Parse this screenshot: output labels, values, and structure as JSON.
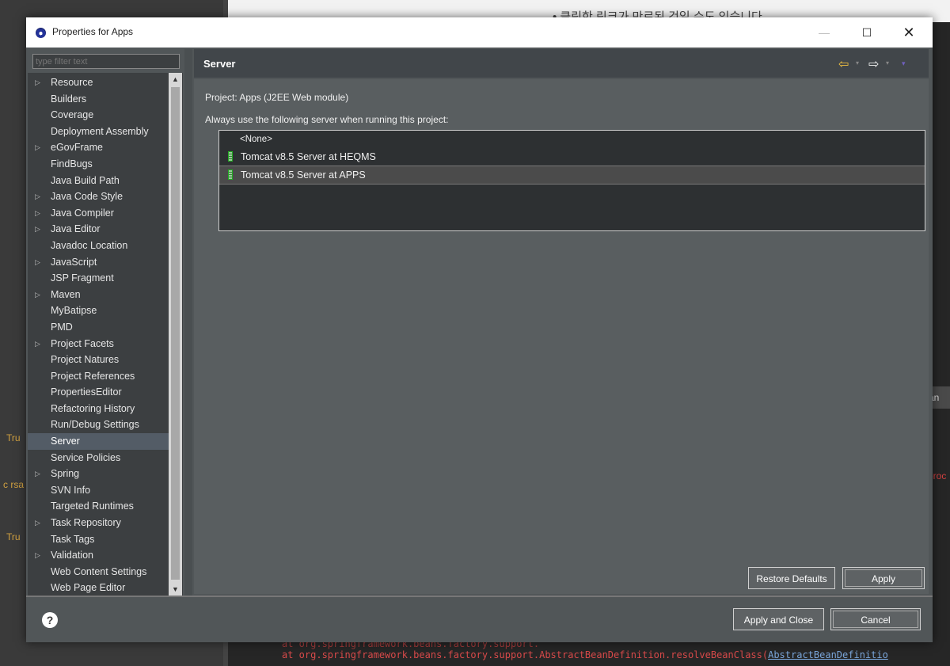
{
  "background": {
    "korean_text": "• 클릭한 링크가 만료된 것일 수도 있습니다.",
    "side_labels": [
      "Tru",
      "c rsa",
      "Tru"
    ],
    "side_tab": "an",
    "red_text": "proc",
    "code_line": "at org.springframework.beans.factory.support.AbstractBeanDefinition.resolveBeanClass(",
    "code_link": "AbstractBeanDefinitio"
  },
  "dialog": {
    "title": "Properties for Apps",
    "controls": {
      "minimize": "—",
      "maximize": "☐",
      "close": "✕"
    },
    "filter": {
      "placeholder": "type filter text"
    },
    "tree": [
      {
        "label": "Resource",
        "expandable": true
      },
      {
        "label": "Builders",
        "expandable": false
      },
      {
        "label": "Coverage",
        "expandable": false
      },
      {
        "label": "Deployment Assembly",
        "expandable": false
      },
      {
        "label": "eGovFrame",
        "expandable": true
      },
      {
        "label": "FindBugs",
        "expandable": false
      },
      {
        "label": "Java Build Path",
        "expandable": false
      },
      {
        "label": "Java Code Style",
        "expandable": true
      },
      {
        "label": "Java Compiler",
        "expandable": true
      },
      {
        "label": "Java Editor",
        "expandable": true
      },
      {
        "label": "Javadoc Location",
        "expandable": false
      },
      {
        "label": "JavaScript",
        "expandable": true
      },
      {
        "label": "JSP Fragment",
        "expandable": false
      },
      {
        "label": "Maven",
        "expandable": true
      },
      {
        "label": "MyBatipse",
        "expandable": false
      },
      {
        "label": "PMD",
        "expandable": false
      },
      {
        "label": "Project Facets",
        "expandable": true
      },
      {
        "label": "Project Natures",
        "expandable": false
      },
      {
        "label": "Project References",
        "expandable": false
      },
      {
        "label": "PropertiesEditor",
        "expandable": false
      },
      {
        "label": "Refactoring History",
        "expandable": false
      },
      {
        "label": "Run/Debug Settings",
        "expandable": false
      },
      {
        "label": "Server",
        "expandable": false,
        "selected": true
      },
      {
        "label": "Service Policies",
        "expandable": false
      },
      {
        "label": "Spring",
        "expandable": true
      },
      {
        "label": "SVN Info",
        "expandable": false
      },
      {
        "label": "Targeted Runtimes",
        "expandable": false
      },
      {
        "label": "Task Repository",
        "expandable": true
      },
      {
        "label": "Task Tags",
        "expandable": false
      },
      {
        "label": "Validation",
        "expandable": true
      },
      {
        "label": "Web Content Settings",
        "expandable": false
      },
      {
        "label": "Web Page Editor",
        "expandable": false
      }
    ],
    "page": {
      "title": "Server",
      "project_label": "Project: Apps (J2EE Web module)",
      "hint": "Always use the following server when running this project:",
      "servers": [
        {
          "label": "<None>",
          "icon": "none"
        },
        {
          "label": "Tomcat v8.5 Server at HEQMS",
          "icon": "server-icon"
        },
        {
          "label": "Tomcat v8.5 Server at APPS",
          "icon": "server-icon",
          "selected": true
        }
      ]
    },
    "buttons": {
      "restore_defaults": "Restore Defaults",
      "apply": "Apply",
      "apply_and_close": "Apply and Close",
      "cancel": "Cancel"
    },
    "nav": {
      "back": "⇦",
      "forward": "⇨",
      "dropdown": "▾"
    },
    "help": "?"
  },
  "colors": {
    "accent_back_arrow": "#f0c040",
    "selection": "#535c66",
    "dialog_bg": "#515658"
  }
}
